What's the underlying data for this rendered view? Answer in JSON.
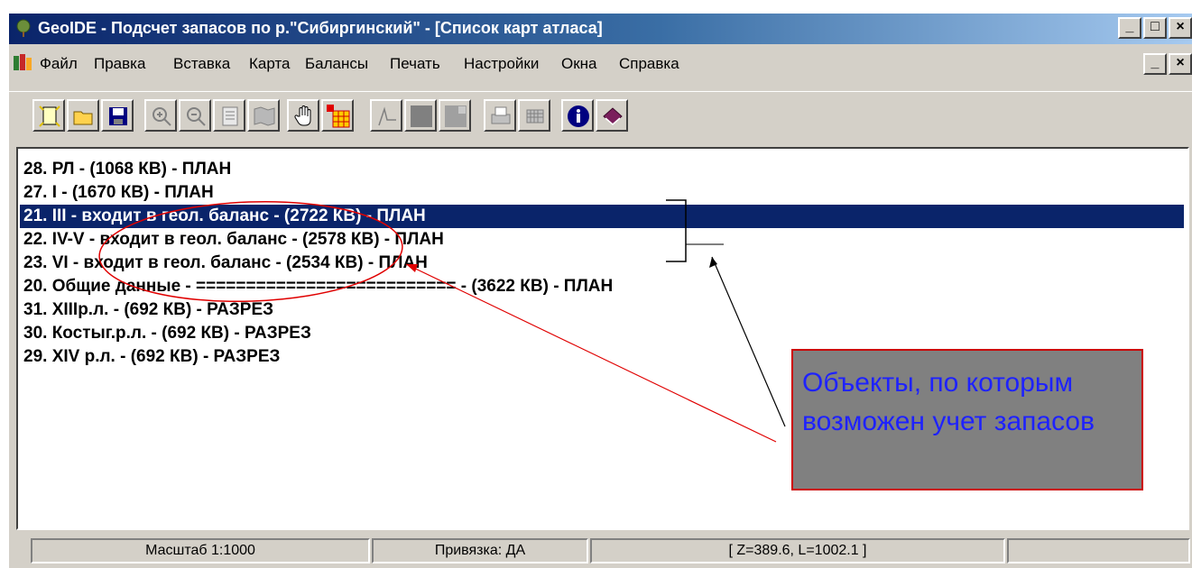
{
  "window": {
    "title": "GeoIDE - Подсчет запасов по р.\"Сибиргинский\" - [Список карт атласа]",
    "caption_buttons": [
      "_",
      "□",
      "×"
    ],
    "mdi_buttons": [
      "_",
      "▫",
      "×"
    ]
  },
  "menu": {
    "items": [
      "Файл",
      "Правка",
      "Вставка",
      "Карта",
      "Балансы",
      "Печать",
      "Настройки",
      "Окна",
      "Справка"
    ]
  },
  "toolbar": {
    "buttons": [
      "new-file-icon",
      "open-folder-icon",
      "save-icon",
      "zoom-in-icon",
      "zoom-out-icon",
      "page-icon",
      "map-icon",
      "hand-icon",
      "grid-cursor-icon",
      "line-tool-icon",
      "fill-dark-icon",
      "fill-light-icon",
      "print-icon",
      "grid-icon",
      "info-icon",
      "book-icon"
    ]
  },
  "list": {
    "rows": [
      "28. РЛ  - (1068 КВ) - ПЛАН",
      "27. I  - (1670 КВ) - ПЛАН",
      "21. III  - входит в геол. баланс - (2722 КВ) - ПЛАН",
      "22. IV-V - входит в геол. баланс - (2578 КВ) - ПЛАН",
      "23. VI  - входит в геол. баланс - (2534 КВ) - ПЛАН",
      "20. Общие данные - ========================== - (3622 КВ) - ПЛАН",
      "31. XIIIр.л.  - (692 КВ) - РАЗРЕЗ",
      "30. Костыг.р.л.  - (692 КВ) - РАЗРЕЗ",
      "29. XIV р.л.  - (692 КВ) - РАЗРЕЗ"
    ],
    "selected_index": 2
  },
  "annotation": {
    "text": "Объекты, по которым возможен учет запасов",
    "text_color": "#1e22ff",
    "box_color": "#808080",
    "border_color": "#cc0000"
  },
  "status": {
    "scale": "Масштаб 1:1000",
    "binding": "Привязка: ДА",
    "coords": "[ Z=389.6, L=1002.1 ]"
  }
}
